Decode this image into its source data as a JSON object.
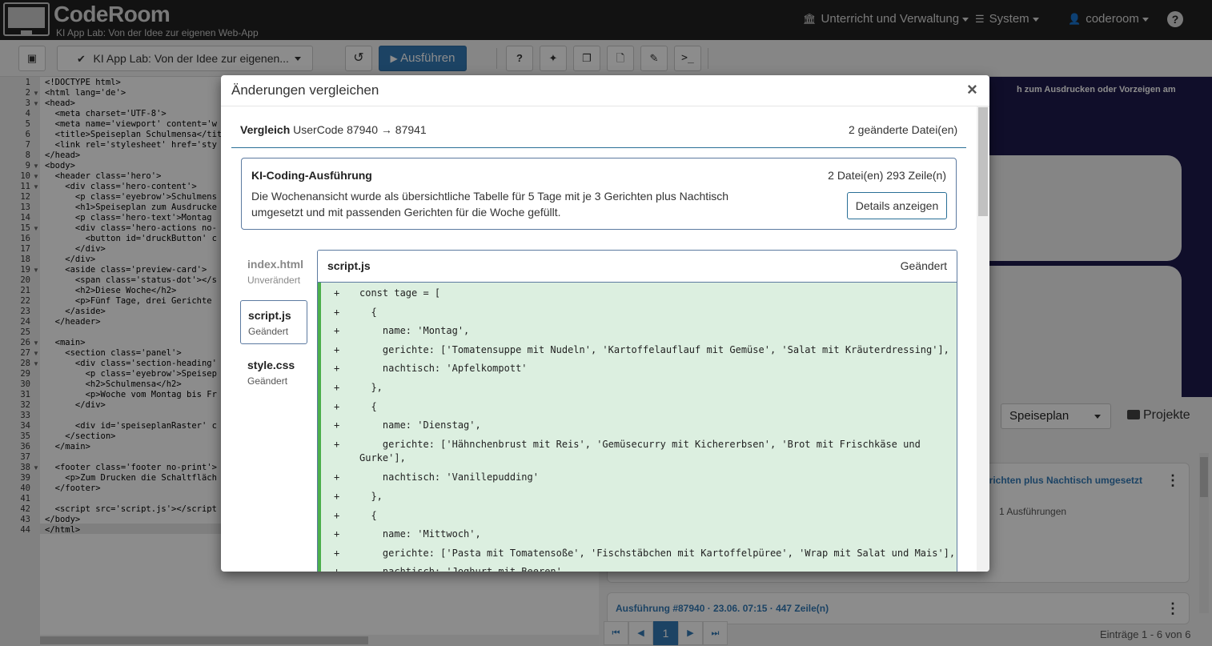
{
  "app": {
    "title": "CodeRoom",
    "subtitle": "KI App Lab: Von der Idee zur eigenen Web-App",
    "nav": [
      {
        "label": "Unterricht und Verwaltung",
        "icon": "institution-icon"
      },
      {
        "label": "System",
        "icon": "list-icon"
      },
      {
        "label": "coderoom",
        "icon": "user-icon"
      }
    ],
    "help_icon": "?"
  },
  "toolbar": {
    "project_select": "KI App Lab: Von der Idee zur eigenen...",
    "run_label": "Ausführen",
    "terminal_label": ">_"
  },
  "editor": {
    "lines": [
      "<!DOCTYPE html>",
      "<html lang='de'>",
      "<head>",
      "  <meta charset='UTF-8'>",
      "  <meta name='viewport' content='w",
      "  <title>Speiseplan Schulmensa</tit",
      "  <link rel='stylesheet' href='sty",
      "</head>",
      "<body>",
      "  <header class='hero'>",
      "    <div class='hero-content'>",
      "      <p class='eyebrow'>Schulmens",
      "      <h1>Speiseplan zum Ausdrucke",
      "      <p class='hero-text'>Montag ",
      "      <div class='hero-actions no-",
      "        <button id='druckButton' c",
      "      </div>",
      "    </div>",
      "    <aside class='preview-card'>",
      "      <span class='status-dot'></s",
      "      <h2>Diese Woche</h2>",
      "      <p>Fünf Tage, drei Gerichte ",
      "    </aside>",
      "  </header>",
      "",
      "  <main>",
      "    <section class='panel'>",
      "      <div class='section-heading'",
      "        <p class='eyebrow'>Speisep",
      "        <h2>Schulmensa</h2>",
      "        <p>Woche vom Montag bis Fr",
      "      </div>",
      "",
      "      <div id='speiseplanRaster' c",
      "    </section>",
      "  </main>",
      "",
      "  <footer class='footer no-print'>",
      "    <p>Zum Drucken die Schaltfläch",
      "  </footer>",
      "",
      "  <script src='script.js'></script",
      "</body>",
      "</html>"
    ],
    "folded_lines": [
      2,
      3,
      9,
      10,
      11,
      15,
      19,
      26,
      27,
      28,
      38
    ]
  },
  "preview": {
    "text": "h zum Ausdrucken oder Vorzeigen am"
  },
  "history": {
    "project_select": "Speiseplan",
    "projects_label": "Projekte",
    "card1_title": "erichten plus Nachtisch umgesetzt",
    "card1_runs": "1 Ausführungen",
    "card2_title": "Ausführung #87940 · 23.06. 07:15 · 447 Zeile(n)",
    "pager": [
      "⏮",
      "◀",
      "1",
      "▶",
      "⏭"
    ],
    "entries": "Einträge 1 - 6 von 6"
  },
  "modal": {
    "title": "Änderungen vergleichen",
    "close": "×",
    "compare_label": "Vergleich",
    "compare_value": "UserCode 87940 → 87941",
    "changed_files": "2 geänderte Datei(en)",
    "ai": {
      "title": "KI-Coding-Ausführung",
      "stats": "2 Datei(en)  293 Zeile(n)",
      "description": "Die Wochenansicht wurde als übersichtliche Tabelle für 5 Tage mit je 3 Gerichten plus Nachtisch umgesetzt und mit passenden Gerichten für die Woche gefüllt.",
      "details_button": "Details anzeigen"
    },
    "files": [
      {
        "name": "index.html",
        "status": "Unverändert"
      },
      {
        "name": "script.js",
        "status": "Geändert"
      },
      {
        "name": "style.css",
        "status": "Geändert"
      }
    ],
    "diff": {
      "file": "script.js",
      "status": "Geändert",
      "lines": [
        "const tage = [",
        "  {",
        "    name: 'Montag',",
        "    gerichte: ['Tomatensuppe mit Nudeln', 'Kartoffelauflauf mit Gemüse', 'Salat mit Kräuterdressing'],",
        "    nachtisch: 'Apfelkompott'",
        "  },",
        "  {",
        "    name: 'Dienstag',",
        "    gerichte: ['Hähnchenbrust mit Reis', 'Gemüsecurry mit Kichererbsen', 'Brot mit Frischkäse und",
        "Gurke'],",
        "    nachtisch: 'Vanillepudding'",
        "  },",
        "  {",
        "    name: 'Mittwoch',",
        "    gerichte: ['Pasta mit Tomatensoße', 'Fischstäbchen mit Kartoffelpüree', 'Wrap mit Salat und Mais'],",
        "    nachtisch: 'Joghurt mit Beeren'"
      ],
      "prefix": "+"
    }
  }
}
